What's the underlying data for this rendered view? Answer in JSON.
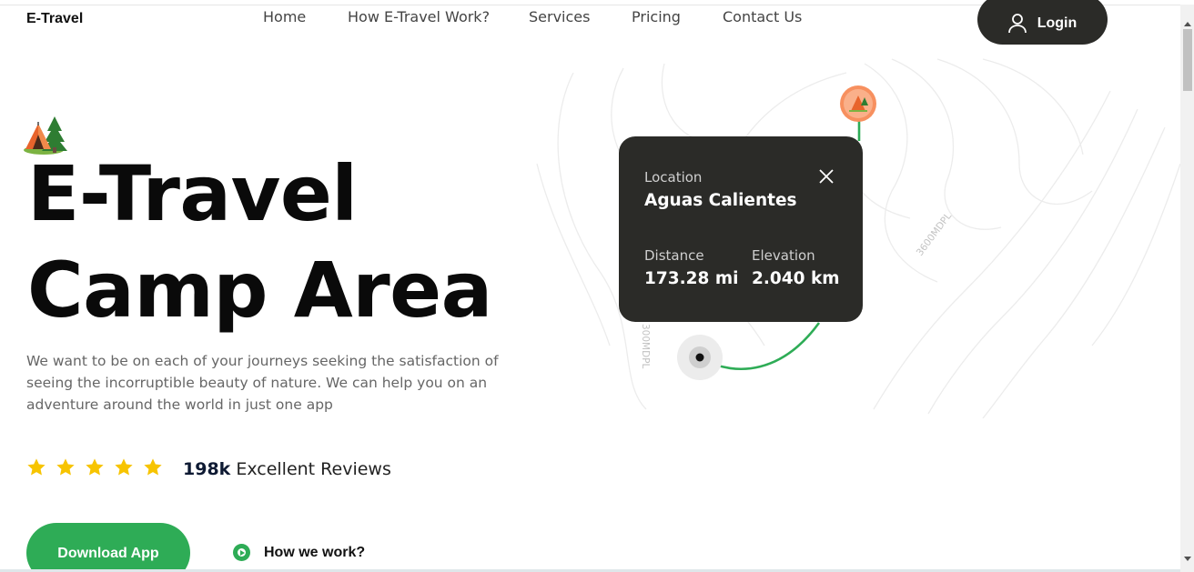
{
  "header": {
    "brand": "E-Travel",
    "nav": [
      "Home",
      "How E-Travel Work?",
      "Services",
      "Pricing",
      "Contact Us"
    ],
    "login_label": "Login",
    "login_icon": "user-icon"
  },
  "hero": {
    "title_line1": "E-Travel",
    "title_line2": "Camp Area",
    "badge_icon": "tent-icon",
    "description": "We want to be on each of your journeys seeking the satisfaction of seeing the incorruptible beauty of nature. We can help you on an adventure around the world in just one app",
    "rating_stars": 5,
    "reviews_count": "198k",
    "reviews_label": "Excellent Reviews",
    "download_label": "Download App",
    "how_label": "How we work?"
  },
  "map": {
    "contour_label_1": "3600MDPL",
    "contour_label_2": "300MDPL",
    "card": {
      "location_label": "Location",
      "location_value": "Aguas Calientes",
      "distance_label": "Distance",
      "distance_value": "173.28 mi",
      "elevation_label": "Elevation",
      "elevation_value": "2.040 km"
    }
  },
  "colors": {
    "accent_green": "#2eac56",
    "dark": "#2b2b28",
    "star": "#f7c400",
    "pin": "#f7905f"
  }
}
